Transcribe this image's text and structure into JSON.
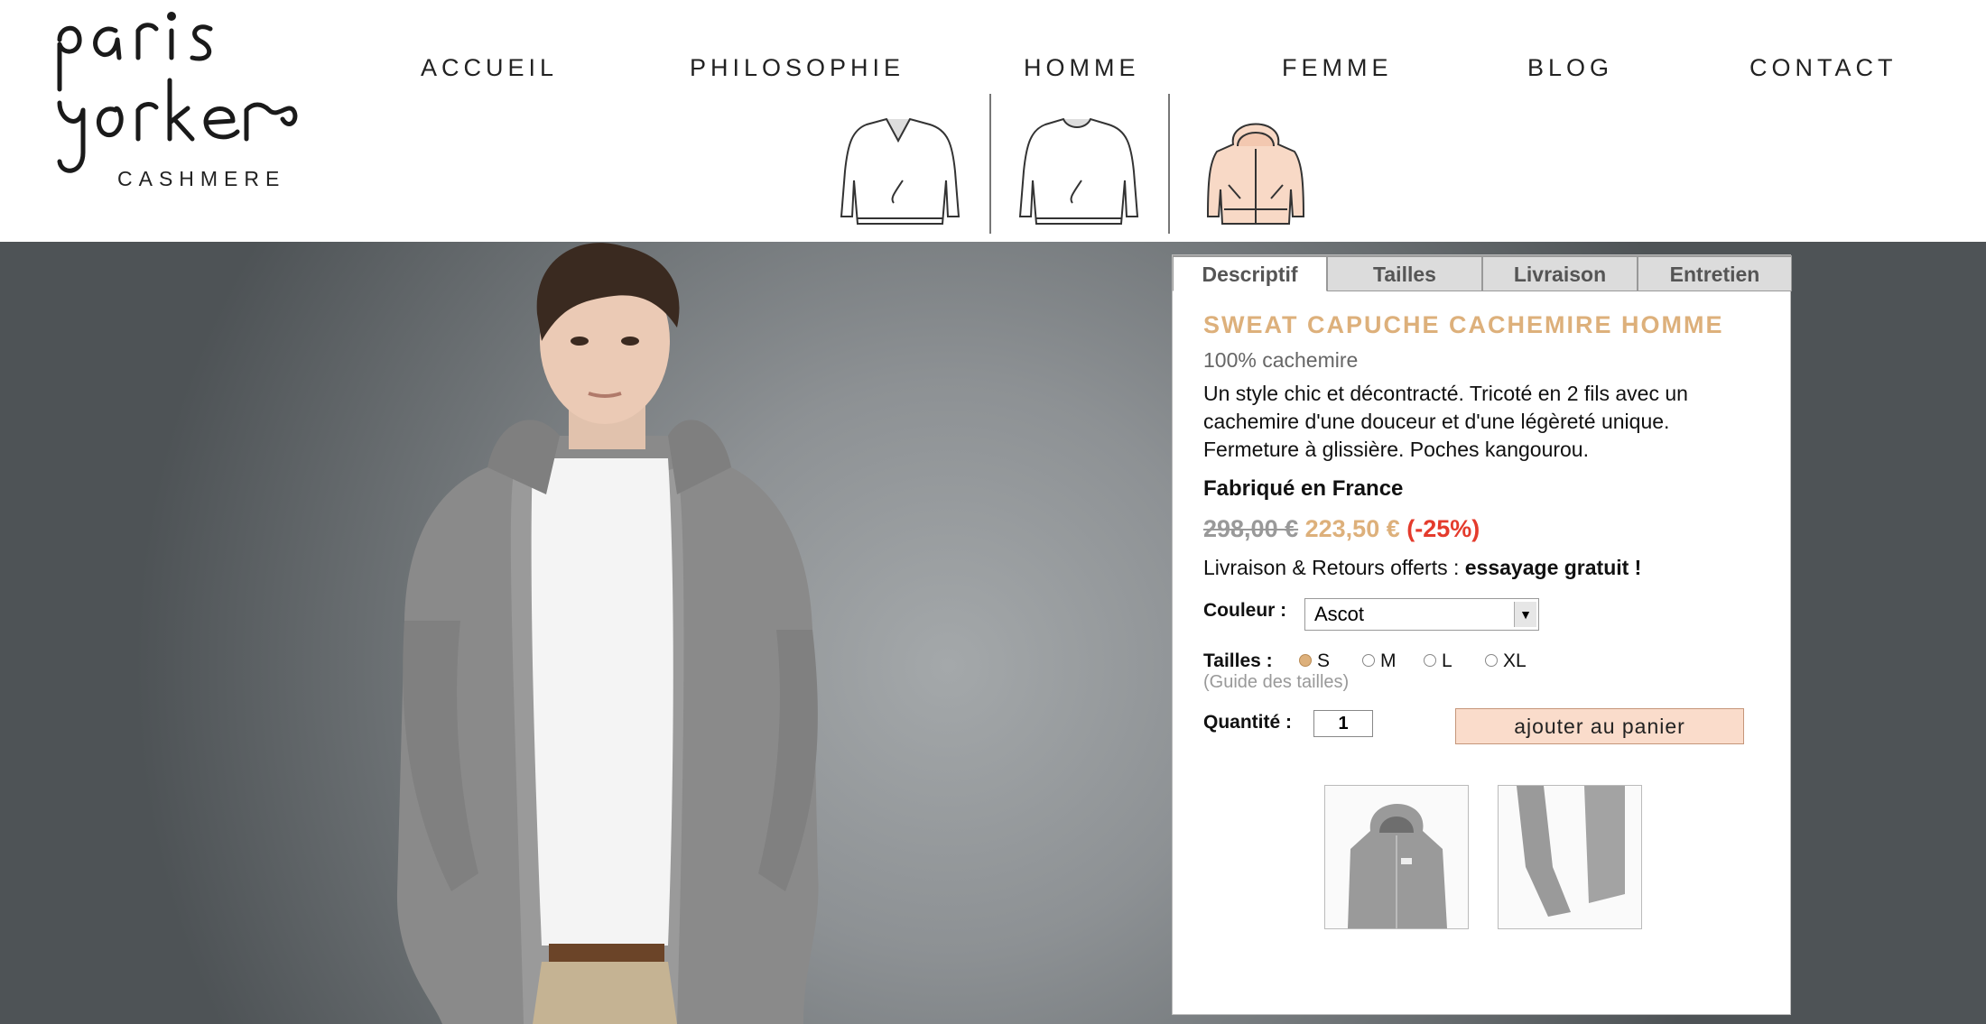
{
  "brand": {
    "logo_line1": "paris",
    "logo_line2": "yorker",
    "logo_sub": "CASHMERE"
  },
  "nav": [
    {
      "label": "ACCUEIL"
    },
    {
      "label": "PHILOSOPHIE"
    },
    {
      "label": "HOMME"
    },
    {
      "label": "FEMME"
    },
    {
      "label": "BLOG"
    },
    {
      "label": "CONTACT"
    }
  ],
  "subnav": [
    {
      "icon": "vneck-sweater-icon"
    },
    {
      "icon": "crewneck-sweater-icon"
    },
    {
      "icon": "hoodie-icon",
      "active": true
    }
  ],
  "tabs": [
    {
      "label": "Descriptif",
      "active": true
    },
    {
      "label": "Tailles"
    },
    {
      "label": "Livraison"
    },
    {
      "label": "Entretien"
    }
  ],
  "product": {
    "title": "SWEAT CAPUCHE CACHEMIRE HOMME",
    "material": "100% cachemire",
    "description": "Un style chic et décontracté. Tricoté en 2 fils avec un cachemire d'une douceur et d'une légèreté unique. Fermeture à glissière. Poches kangourou.",
    "made_in": "Fabriqué en France",
    "price_old": "298,00 €",
    "price_new": "223,50 €",
    "discount": "(-25%)",
    "shipping_text": "Livraison & Retours offerts : ",
    "shipping_bold": "essayage gratuit !",
    "color_label": "Couleur :",
    "color_value": "Ascot",
    "size_label": "Tailles :",
    "sizes": [
      "S",
      "M",
      "L",
      "XL"
    ],
    "selected_size": "S",
    "size_guide": "(Guide des tailles)",
    "qty_label": "Quantité :",
    "qty_value": "1",
    "add_to_cart": "ajouter au panier"
  },
  "colors": {
    "accent": "#ddb07b",
    "discount": "#e43b2c",
    "button_bg": "#fadccb",
    "hoodie_fill": "#f8d9c6"
  }
}
